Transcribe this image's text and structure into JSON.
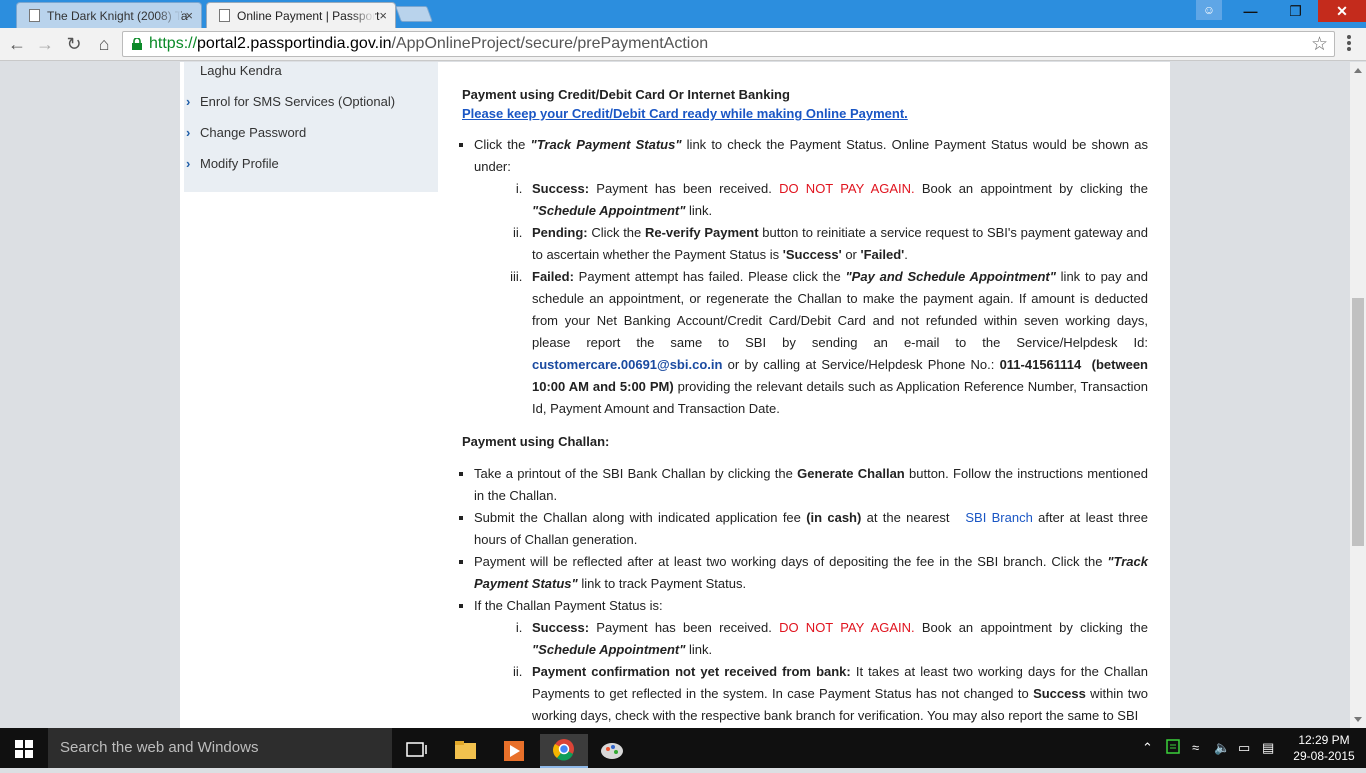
{
  "browser": {
    "tabs": [
      {
        "title": "The Dark Knight (2008) Ta",
        "active": false
      },
      {
        "title": "Online Payment | Passport",
        "active": true
      }
    ],
    "url_scheme": "https://",
    "url_host": "portal2.passportindia.gov.in",
    "url_path": "/AppOnlineProject/secure/prePaymentAction",
    "icons": [
      "back-icon",
      "forward-icon",
      "reload-icon",
      "home-icon",
      "lock-icon",
      "star-icon",
      "menu-icon"
    ]
  },
  "sidebar": {
    "items": [
      {
        "label": "Laghu Kendra",
        "chevron": false
      },
      {
        "label": "Enrol for SMS Services (Optional)",
        "chevron": true
      },
      {
        "label": "Change Password",
        "chevron": true
      },
      {
        "label": "Modify Profile",
        "chevron": true
      }
    ]
  },
  "content": {
    "card_title": "Payment using Credit/Debit Card Or Internet Banking",
    "card_notice": "Please keep your Credit/Debit Card ready while making Online Payment.",
    "challan_title": "Payment using Challan:",
    "colors": {
      "red": "#e0131e",
      "link": "#1a56c4"
    }
  },
  "taskbar": {
    "search_placeholder": "Search the web and Windows",
    "time": "12:29 PM",
    "date": "29-08-2015"
  }
}
